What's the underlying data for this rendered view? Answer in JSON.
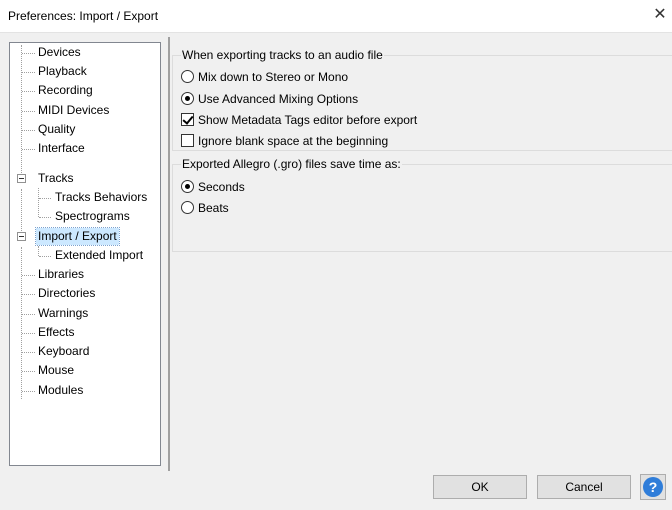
{
  "window": {
    "title": "Preferences: Import / Export",
    "close_glyph": "✕"
  },
  "tree": {
    "items": [
      {
        "label": "Devices"
      },
      {
        "label": "Playback"
      },
      {
        "label": "Recording"
      },
      {
        "label": "MIDI Devices"
      },
      {
        "label": "Quality"
      },
      {
        "label": "Interface"
      },
      {
        "label": "Tracks"
      },
      {
        "label": "Tracks Behaviors"
      },
      {
        "label": "Spectrograms"
      },
      {
        "label": "Import / Export"
      },
      {
        "label": "Extended Import"
      },
      {
        "label": "Libraries"
      },
      {
        "label": "Directories"
      },
      {
        "label": "Warnings"
      },
      {
        "label": "Effects"
      },
      {
        "label": "Keyboard"
      },
      {
        "label": "Mouse"
      },
      {
        "label": "Modules"
      }
    ],
    "selected": "Import / Export"
  },
  "export_group": {
    "title": "When exporting tracks to an audio file",
    "mix_down": {
      "label": "Mix down to Stereo or Mono",
      "checked": false
    },
    "advanced": {
      "label": "Use Advanced Mixing Options",
      "checked": true
    },
    "metadata": {
      "label": "Show Metadata Tags editor before export",
      "checked": true
    },
    "ignore_blank": {
      "label": "Ignore blank space at the beginning",
      "checked": false
    }
  },
  "allegro_group": {
    "title": "Exported Allegro (.gro) files save time as:",
    "seconds": {
      "label": "Seconds",
      "checked": true
    },
    "beats": {
      "label": "Beats",
      "checked": false
    }
  },
  "buttons": {
    "ok": "OK",
    "cancel": "Cancel",
    "help": "?"
  },
  "colors": {
    "selection": "#cce8ff",
    "help_blue": "#2f7dd9",
    "dialog_bg": "#f0f0f0"
  }
}
